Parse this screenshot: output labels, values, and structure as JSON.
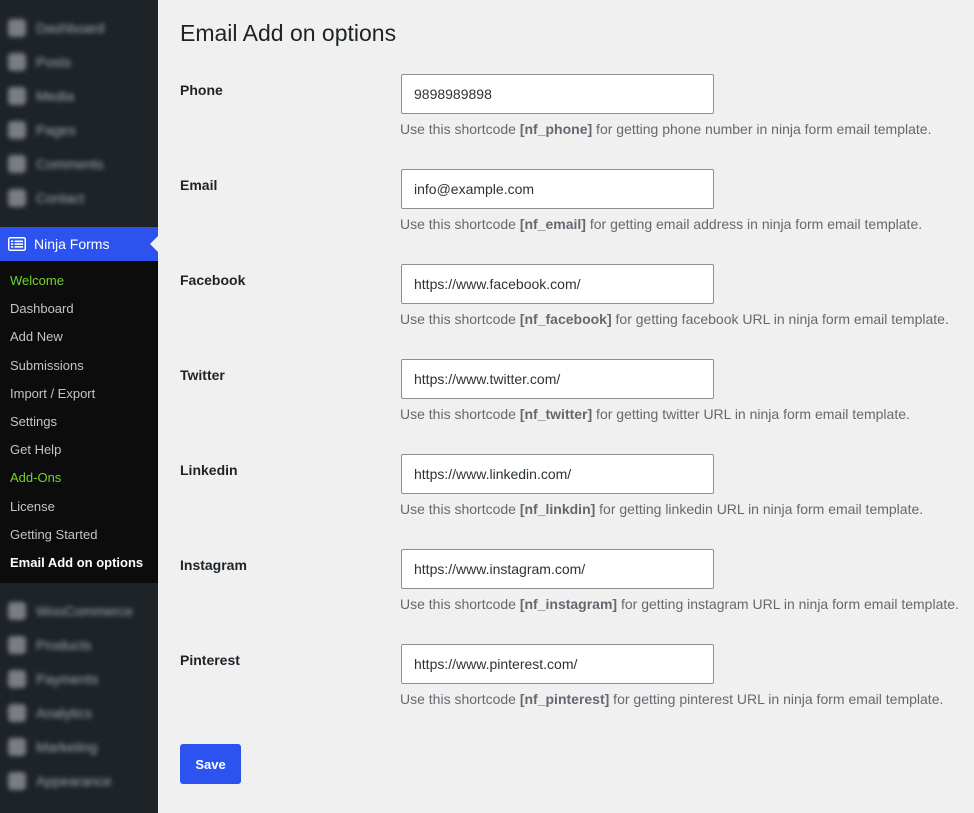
{
  "sidebar": {
    "top_blurred": [
      "Dashboard",
      "Posts",
      "Media",
      "Pages",
      "Comments",
      "Contact"
    ],
    "active_menu": {
      "label": "Ninja Forms",
      "icon": "ninja-forms-icon",
      "color": "#2c53ef"
    },
    "submenu": [
      {
        "label": "Welcome",
        "style": "green"
      },
      {
        "label": "Dashboard",
        "style": "normal"
      },
      {
        "label": "Add New",
        "style": "normal"
      },
      {
        "label": "Submissions",
        "style": "normal"
      },
      {
        "label": "Import / Export",
        "style": "normal"
      },
      {
        "label": "Settings",
        "style": "normal"
      },
      {
        "label": "Get Help",
        "style": "normal"
      },
      {
        "label": "Add-Ons",
        "style": "green"
      },
      {
        "label": "License",
        "style": "normal"
      },
      {
        "label": "Getting Started",
        "style": "normal"
      },
      {
        "label": "Email Add on options",
        "style": "current"
      }
    ],
    "bottom_blurred": [
      "WooCommerce",
      "Products",
      "Payments",
      "Analytics",
      "Marketing",
      "Appearance"
    ]
  },
  "page": {
    "title": "Email Add on options"
  },
  "fields": [
    {
      "label": "Phone",
      "value": "9898989898",
      "desc_prefix": "Use this shortcode ",
      "shortcode": "[nf_phone]",
      "desc_suffix": " for getting phone number in ninja form email template."
    },
    {
      "label": "Email",
      "value": "info@example.com",
      "desc_prefix": "Use this shortcode ",
      "shortcode": "[nf_email]",
      "desc_suffix": " for getting email address in ninja form email template."
    },
    {
      "label": "Facebook",
      "value": "https://www.facebook.com/",
      "desc_prefix": "Use this shortcode ",
      "shortcode": "[nf_facebook]",
      "desc_suffix": " for getting facebook URL in ninja form email template."
    },
    {
      "label": "Twitter",
      "value": "https://www.twitter.com/",
      "desc_prefix": "Use this shortcode ",
      "shortcode": "[nf_twitter]",
      "desc_suffix": " for getting twitter URL in ninja form email template."
    },
    {
      "label": "Linkedin",
      "value": "https://www.linkedin.com/",
      "desc_prefix": "Use this shortcode ",
      "shortcode": "[nf_linkdin]",
      "desc_suffix": " for getting linkedin URL in ninja form email template."
    },
    {
      "label": "Instagram",
      "value": "https://www.instagram.com/",
      "desc_prefix": "Use this shortcode ",
      "shortcode": "[nf_instagram]",
      "desc_suffix": " for getting instagram URL in ninja form email template."
    },
    {
      "label": "Pinterest",
      "value": "https://www.pinterest.com/",
      "desc_prefix": "Use this shortcode ",
      "shortcode": "[nf_pinterest]",
      "desc_suffix": " for getting pinterest URL in ninja form email template."
    }
  ],
  "save_label": "Save",
  "colors": {
    "accent": "#2c53ef",
    "submenu_green": "#72d52a",
    "sidebar_bg": "#1d2327"
  }
}
